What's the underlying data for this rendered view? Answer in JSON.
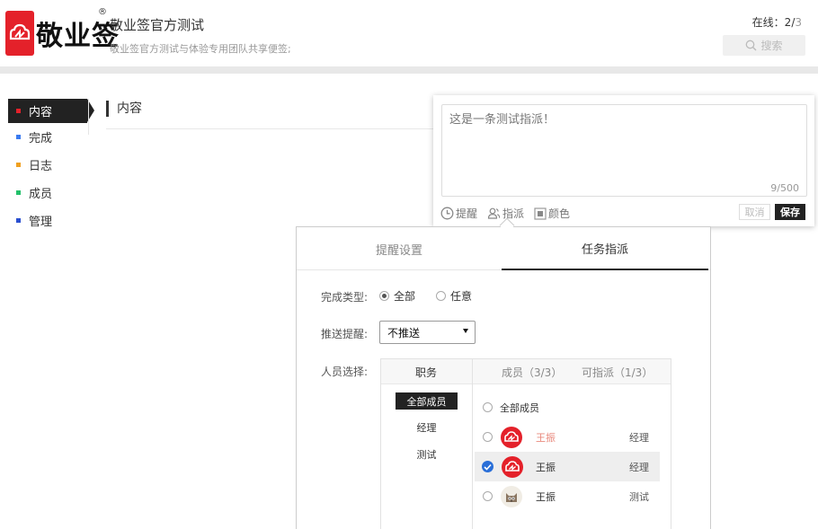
{
  "header": {
    "logo_text": "敬业签",
    "logo_reg": "®",
    "title": "敬业签官方测试",
    "subtitle": "敬业签官方测试与体验专用团队共享便签;",
    "online_label": "在线：",
    "online_count": "2",
    "online_sep": "/",
    "online_total": "3",
    "search_placeholder": "搜索"
  },
  "sidebar": {
    "items": [
      {
        "label": "内容",
        "color": "#e4212a"
      },
      {
        "label": "完成",
        "color": "#3a7bf0"
      },
      {
        "label": "日志",
        "color": "#f0a020"
      },
      {
        "label": "成员",
        "color": "#22c06a"
      },
      {
        "label": "管理",
        "color": "#2a4fd0"
      }
    ]
  },
  "content": {
    "title": "内容"
  },
  "editor": {
    "text": "这是一条测试指派！",
    "count": "9/500",
    "tools": {
      "remind": "提醒",
      "assign": "指派",
      "color": "颜色"
    },
    "cancel": "取消",
    "save": "保存"
  },
  "popover": {
    "tabs": [
      "提醒设置",
      "任务指派"
    ],
    "finish_type_label": "完成类型:",
    "finish_options": [
      "全部",
      "任意"
    ],
    "push_label": "推送提醒:",
    "push_value": "不推送",
    "people_label": "人员选择:",
    "head": {
      "role": "职务",
      "members": "成员（3/3）",
      "assign": "可指派（1/3）"
    },
    "roles": [
      "全部成员",
      "经理",
      "测试"
    ],
    "all_members": "全部成员",
    "members": [
      {
        "name": "王振",
        "role": "经理",
        "selected": false
      },
      {
        "name": "王振",
        "role": "经理",
        "selected": true
      },
      {
        "name": "王振",
        "role": "测试",
        "selected": false
      }
    ]
  }
}
